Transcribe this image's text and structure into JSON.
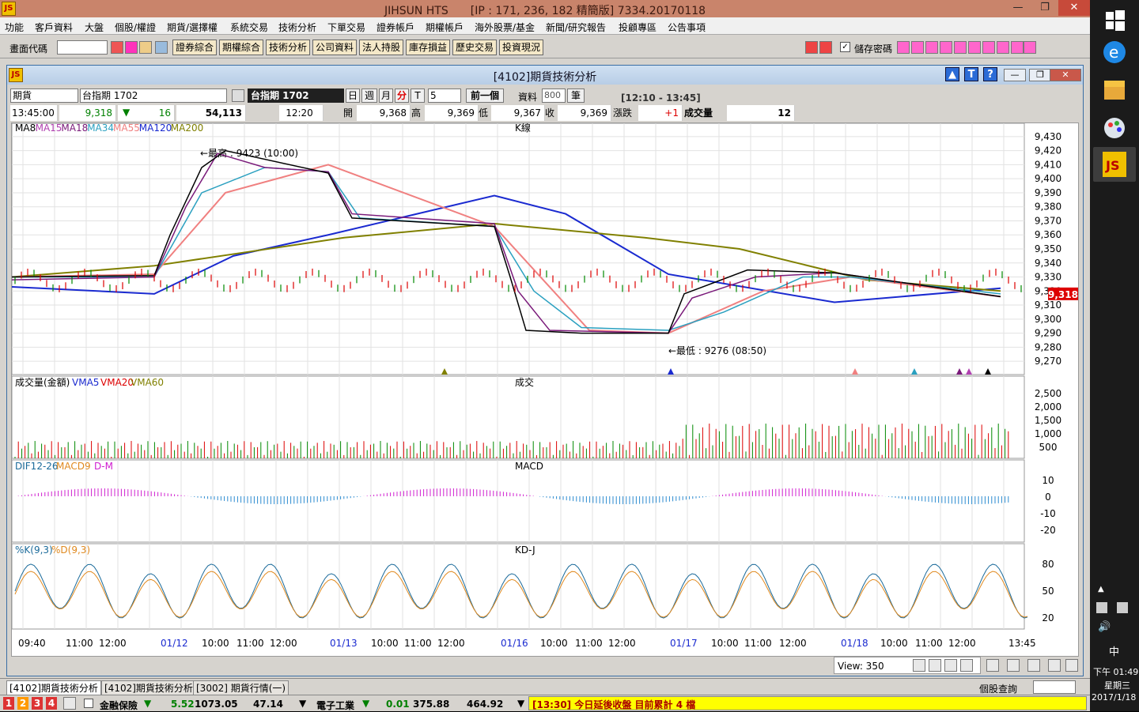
{
  "app": {
    "title": "JIHSUN HTS　　[IP : 171, 236, 182 精簡版] 7334.20170118",
    "logo": "JS",
    "min": "—",
    "restore": "❐",
    "close": "✕"
  },
  "menu": [
    "功能",
    "客戶資料",
    "大盤",
    "個股/權證",
    "期貨/選擇權",
    "系統交易",
    "技術分析",
    "下單交易",
    "證券帳戶",
    "期權帳戶",
    "海外股票/基金",
    "新聞/研究報告",
    "投顧專區",
    "公告事項"
  ],
  "toolbar": {
    "code_label": "畫面代碼",
    "buttons": [
      "證券綜合",
      "期權綜合",
      "技術分析",
      "公司資料",
      "法人持股",
      "庫存損益",
      "歷史交易",
      "投資現況"
    ],
    "save_pw": "儲存密碼"
  },
  "window": {
    "title": "[4102]期貨技術分析",
    "product_type": "期貨",
    "symbol": "台指期 1702",
    "symbol_display": "台指期 1702",
    "periods": [
      "日",
      "週",
      "月",
      "分",
      "T"
    ],
    "active_period": "分",
    "interval": "5",
    "prev_btn": "前一個",
    "data_label": "資料",
    "count": "800",
    "count_unit": "筆",
    "range": "[12:10 - 13:45]"
  },
  "quote": {
    "time": "13:45:00",
    "price": "9,318",
    "change": "16",
    "volume_total": "54,113",
    "bar_time": "12:20",
    "open_label": "開",
    "open": "9,368",
    "high_label": "高",
    "high": "9,369",
    "low_label": "低",
    "low": "9,367",
    "close_label": "收",
    "close": "9,369",
    "chg_label": "漲跌",
    "chg": "+1",
    "vol_label": "成交量",
    "vol": "12"
  },
  "chart_data": {
    "type": "line",
    "panels": [
      {
        "name": "K線",
        "legend": [
          "MA8",
          "MA15",
          "MA18",
          "MA34",
          "MA55",
          "MA120",
          "MA200"
        ],
        "legend_colors": [
          "#000000",
          "#b040b0",
          "#7a1a7a",
          "#2aa0c0",
          "#f08080",
          "#1a2ad0",
          "#808000"
        ],
        "ylim": [
          9265,
          9435
        ],
        "yticks": [
          9430,
          9420,
          9410,
          9400,
          9390,
          9380,
          9370,
          9360,
          9350,
          9340,
          9330,
          9320,
          9310,
          9300,
          9290,
          9280,
          9270
        ],
        "high_note": "最高 : 9423 (10:00)",
        "low_note": "最低 : 9276 (08:50)",
        "last": "9,318"
      },
      {
        "name": "成交",
        "legend": [
          "成交量(金額)",
          "VMA5",
          "VMA20",
          "VMA60"
        ],
        "yticks": [
          "2,500",
          "2,000",
          "1,500",
          "1,000",
          "500"
        ]
      },
      {
        "name": "MACD",
        "legend": [
          "DIF12-26",
          "MACD9",
          "D-M"
        ],
        "yticks": [
          "10",
          "0",
          "-10",
          "-20"
        ]
      },
      {
        "name": "KD-J",
        "legend": [
          "%K(9,3)",
          "%D(9,3)"
        ],
        "yticks": [
          "80",
          "50",
          "20"
        ]
      }
    ],
    "xticks": [
      "09:40",
      "11:00",
      "12:00",
      "01/12",
      "10:00",
      "11:00",
      "12:00",
      "01/13",
      "10:00",
      "11:00",
      "12:00",
      "01/16",
      "10:00",
      "11:00",
      "12:00",
      "01/17",
      "10:00",
      "11:00",
      "12:00",
      "01/18",
      "10:00",
      "11:00",
      "12:00",
      "13:45"
    ],
    "view": "View: 350"
  },
  "tabs": [
    "[4102]期貨技術分析",
    "[4102]期貨技術分析",
    "[3002] 期貨行情(一)"
  ],
  "stock_query": "個股查詢",
  "status": {
    "nums": [
      "1",
      "2",
      "3",
      "4"
    ],
    "sec1_name": "金融保險",
    "sec1_chg": "5.52",
    "sec1_idx": "1073.05",
    "sec1_vol": "47.14",
    "sec2_name": "電子工業",
    "sec2_chg": "0.01",
    "sec2_idx": "375.88",
    "sec2_vol": "464.92",
    "ticker": "[13:30] 今日延後收盤 目前累計 4 檔"
  },
  "taskbar": {
    "ime": "中",
    "time": "下午 01:49",
    "weekday": "星期三",
    "date": "2017/1/18"
  }
}
